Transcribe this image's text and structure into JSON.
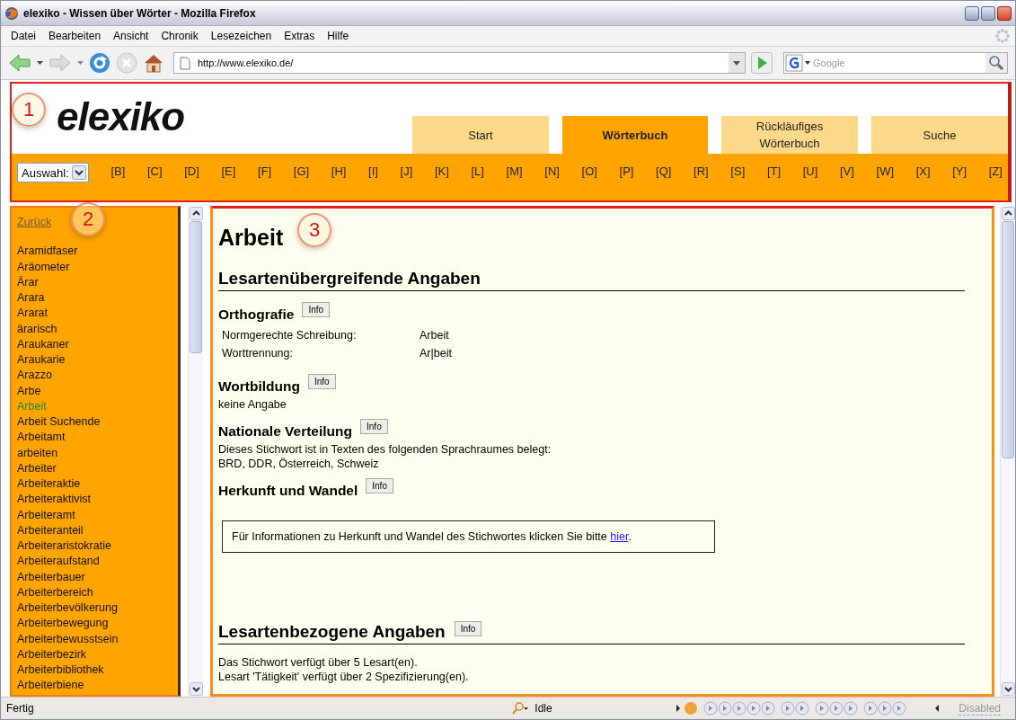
{
  "window": {
    "title": "elexiko - Wissen über Wörter - Mozilla Firefox"
  },
  "menu": [
    "Datei",
    "Bearbeiten",
    "Ansicht",
    "Chronik",
    "Lesezeichen",
    "Extras",
    "Hilfe"
  ],
  "address": {
    "value": "http://www.elexiko.de/"
  },
  "search": {
    "placeholder": "Google"
  },
  "site": {
    "logo": "elexiko",
    "tabs": [
      {
        "label": "Start",
        "selected": false
      },
      {
        "label": "Wörterbuch",
        "selected": true
      },
      {
        "label": "Rückläufiges Wörterbuch",
        "selected": false
      },
      {
        "label": "Suche",
        "selected": false
      }
    ],
    "select": {
      "value": "Auswahl:"
    },
    "letters": [
      "[B]",
      "[C]",
      "[D]",
      "[E]",
      "[F]",
      "[G]",
      "[H]",
      "[I]",
      "[J]",
      "[K]",
      "[L]",
      "[M]",
      "[N]",
      "[O]",
      "[P]",
      "[Q]",
      "[R]",
      "[S]",
      "[T]",
      "[U]",
      "[V]",
      "[W]",
      "[X]",
      "[Y]",
      "[Z]"
    ]
  },
  "sidebar": {
    "back": "Zurück",
    "items": [
      {
        "label": "Aramidfaser",
        "selected": false
      },
      {
        "label": "Aräometer",
        "selected": false
      },
      {
        "label": "Ärar",
        "selected": false
      },
      {
        "label": "Arara",
        "selected": false
      },
      {
        "label": "Ararat",
        "selected": false
      },
      {
        "label": "ärarisch",
        "selected": false
      },
      {
        "label": "Araukaner",
        "selected": false
      },
      {
        "label": "Araukarie",
        "selected": false
      },
      {
        "label": "Arazzo",
        "selected": false
      },
      {
        "label": "Arbe",
        "selected": false
      },
      {
        "label": "Arbeit",
        "selected": true
      },
      {
        "label": "Arbeit Suchende",
        "selected": false
      },
      {
        "label": "Arbeitamt",
        "selected": false
      },
      {
        "label": "arbeiten",
        "selected": false
      },
      {
        "label": "Arbeiter",
        "selected": false
      },
      {
        "label": "Arbeiteraktie",
        "selected": false
      },
      {
        "label": "Arbeiteraktivist",
        "selected": false
      },
      {
        "label": "Arbeiteramt",
        "selected": false
      },
      {
        "label": "Arbeiteranteil",
        "selected": false
      },
      {
        "label": "Arbeiteraristokratie",
        "selected": false
      },
      {
        "label": "Arbeiteraufstand",
        "selected": false
      },
      {
        "label": "Arbeiterbauer",
        "selected": false
      },
      {
        "label": "Arbeiterbereich",
        "selected": false
      },
      {
        "label": "Arbeiterbevölkerung",
        "selected": false
      },
      {
        "label": "Arbeiterbewegung",
        "selected": false
      },
      {
        "label": "Arbeiterbewusstsein",
        "selected": false
      },
      {
        "label": "Arbeiterbezirk",
        "selected": false
      },
      {
        "label": "Arbeiterbibliothek",
        "selected": false
      },
      {
        "label": "Arbeiterbiene",
        "selected": false
      }
    ]
  },
  "entry": {
    "title": "Arbeit",
    "general": {
      "heading": "Lesartenübergreifende Angaben",
      "topics": [
        {
          "heading": "Orthografie",
          "info": "Info",
          "kind": "pairs",
          "rows": [
            [
              "Normgerechte Schreibung:",
              "Arbeit"
            ],
            [
              "Worttrennung:",
              "Ar|beit"
            ]
          ]
        },
        {
          "heading": "Wortbildung",
          "info": "Info",
          "kind": "text",
          "lines": [
            "keine Angabe"
          ]
        },
        {
          "heading": "Nationale Verteilung",
          "info": "Info",
          "kind": "text",
          "lines": [
            "Dieses Stichwort ist in Texten des folgenden Sprachraumes belegt:",
            "BRD, DDR, Österreich, Schweiz"
          ]
        },
        {
          "heading": "Herkunft und Wandel",
          "info": "Info",
          "kind": "box",
          "text": "Für Informationen zu Herkunft und Wandel des Stichwortes klicken Sie bitte ",
          "link": "hier",
          "after": "."
        }
      ]
    },
    "specific": {
      "heading": "Lesartenbezogene Angaben",
      "info": "Info",
      "lines": [
        "Das Stichwort verfügt über 5 Lesart(en).",
        "Lesart 'Tätigkeit' verfügt über 2 Spezifizierung(en)."
      ]
    }
  },
  "callouts": [
    "1",
    "2",
    "3"
  ],
  "status_bar": {
    "text": "Fertig",
    "player": "Idle",
    "player_state": "Disabled"
  }
}
